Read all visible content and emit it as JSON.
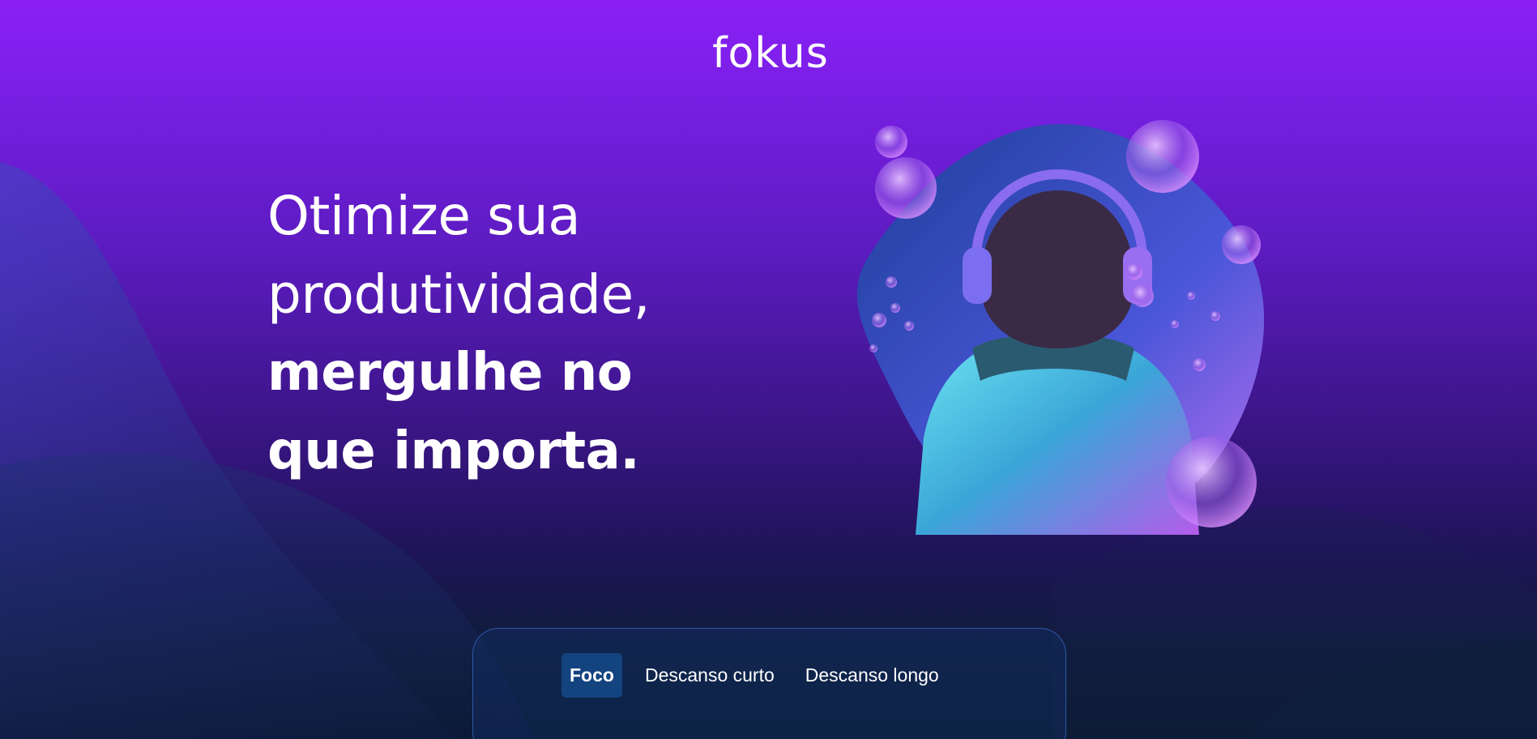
{
  "logo": {
    "text": "fokus"
  },
  "hero": {
    "line1": "Otimize sua",
    "line2": "produtividade,",
    "line3": "mergulhe no",
    "line4": "que importa."
  },
  "image": {
    "alt": "Pessoa de costas usando fones de ouvido, cercada por bolhas"
  },
  "tabs": [
    {
      "label": "Foco",
      "active": true
    },
    {
      "label": "Descanso curto",
      "active": false
    },
    {
      "label": "Descanso longo",
      "active": false
    }
  ],
  "colors": {
    "background_top": "#8b1ff5",
    "background_bottom": "#081a2c",
    "active_tab": "#144480",
    "panel_border": "#4682e6"
  }
}
